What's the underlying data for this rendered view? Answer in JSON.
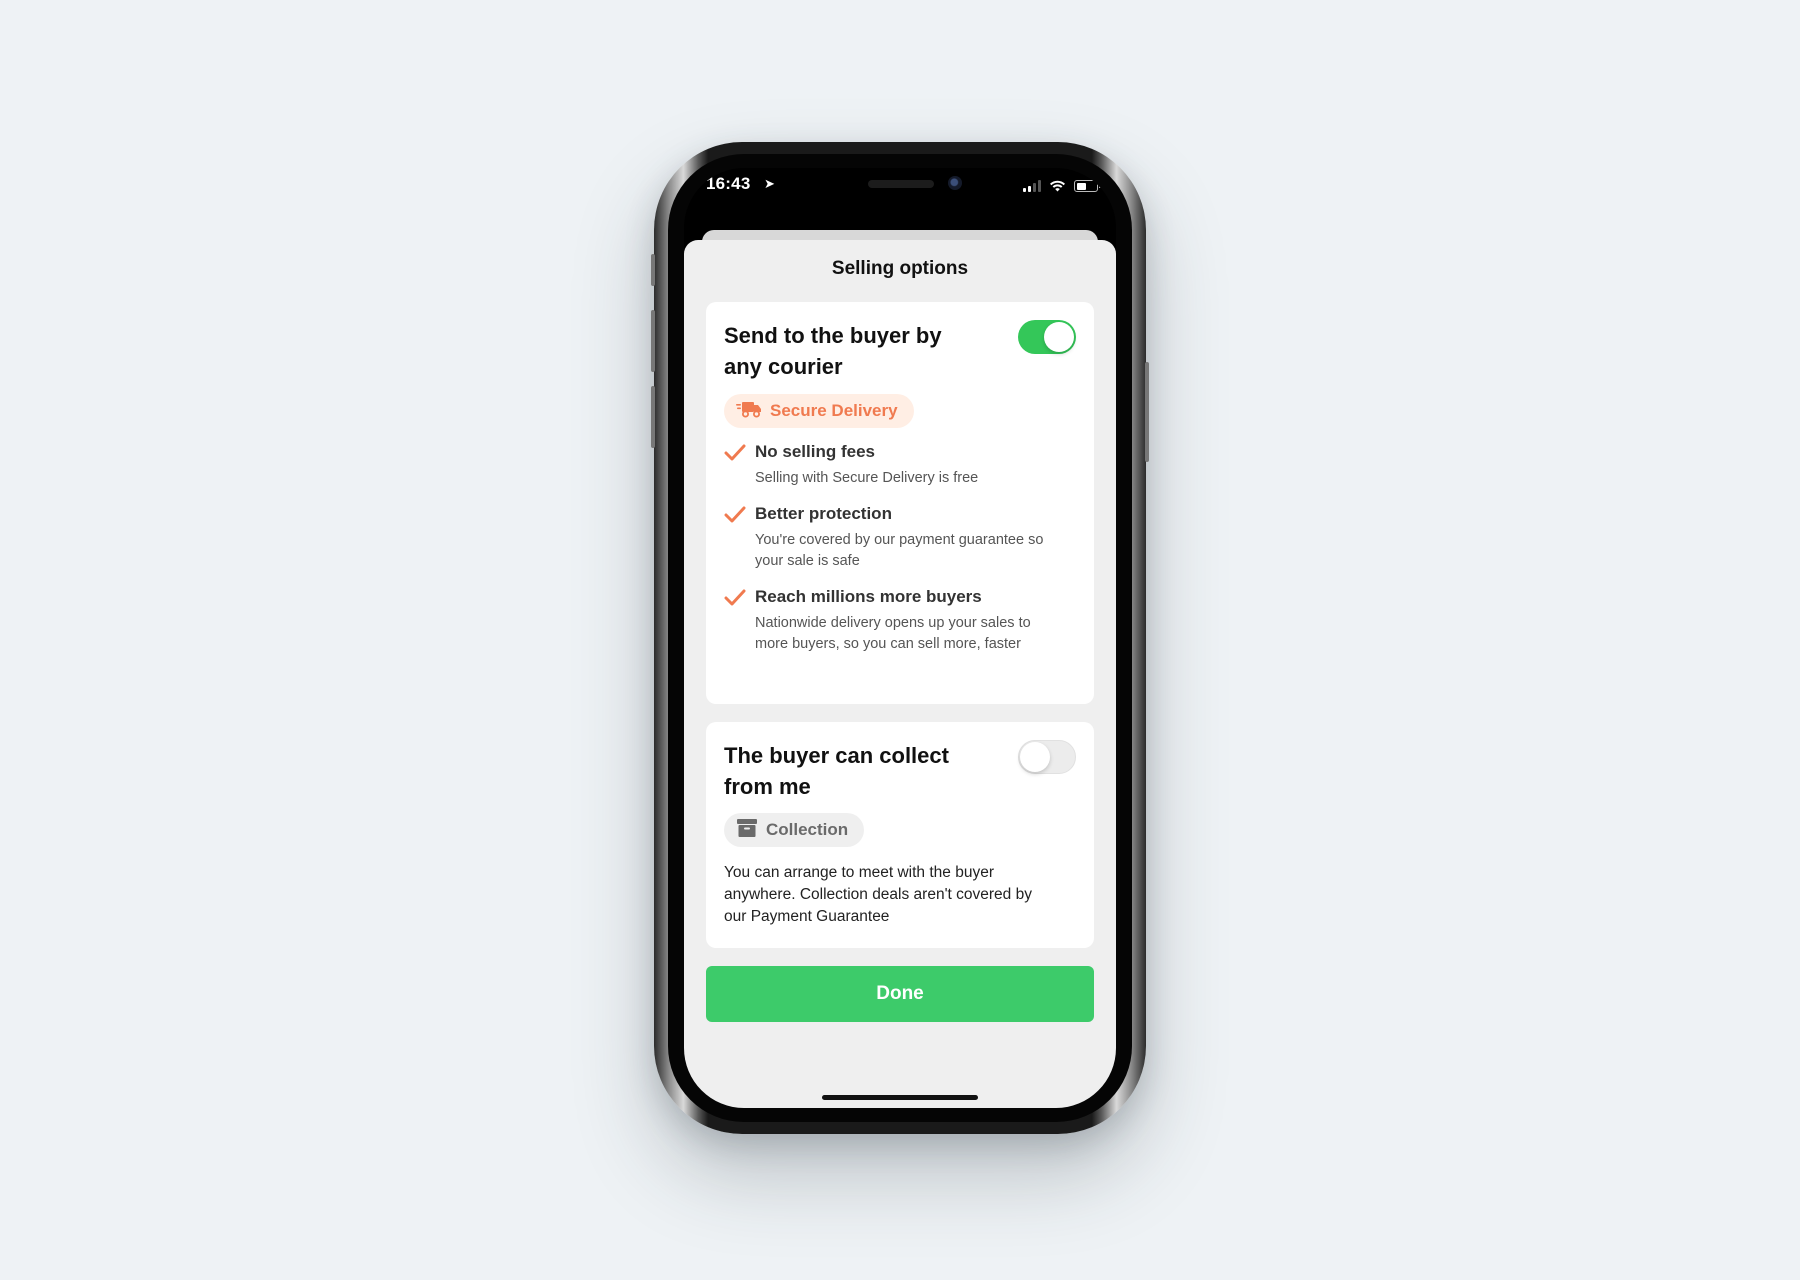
{
  "status_bar": {
    "time": "16:43",
    "location_glyph": "➤",
    "signal_icon": "signal-icon",
    "wifi_icon": "wifi-icon",
    "battery_level": 0.55
  },
  "sheet": {
    "title": "Selling options"
  },
  "courier_option": {
    "title": "Send to the buyer by any courier",
    "enabled": true,
    "badge_label": "Secure Delivery",
    "badge_icon": "delivery-truck-icon",
    "benefits": [
      {
        "title": "No selling fees",
        "description": "Selling with Secure Delivery is free"
      },
      {
        "title": "Better protection",
        "description": "You're covered by our payment guarantee so your sale is safe"
      },
      {
        "title": "Reach millions more buyers",
        "description": "Nationwide delivery opens up your sales to more buyers, so you can sell more, faster"
      }
    ]
  },
  "collection_option": {
    "title": "The buyer can collect from me",
    "enabled": false,
    "badge_label": "Collection",
    "badge_icon": "archive-box-icon",
    "description": "You can arrange to meet with the buyer anywhere. Collection deals aren't covered by our Payment Guarantee"
  },
  "actions": {
    "done_label": "Done"
  },
  "colors": {
    "toggle_on": "#34c759",
    "done_button": "#3dcb6a",
    "accent_orange": "#f07a4f",
    "secure_badge_bg": "#ffeee4"
  }
}
